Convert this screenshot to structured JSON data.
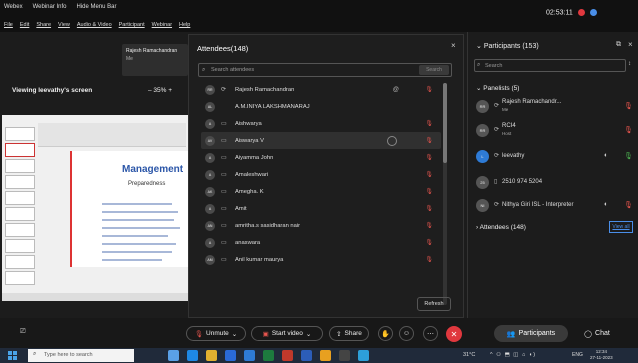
{
  "menubar": {
    "app": "Webex",
    "webinar_info": "Webinar Info",
    "hide_menu_bar": "Hide Menu Bar",
    "items": [
      "File",
      "Edit",
      "Share",
      "View",
      "Audio & Video",
      "Participant",
      "Webinar",
      "Help"
    ],
    "clock": "02:53:11"
  },
  "stage": {
    "speaker_card": {
      "name": "Rajesh Ramachandran",
      "role": "Me"
    },
    "view_label": "Viewing leevathy's screen",
    "zoom": "35%",
    "slide_title": "Management",
    "slide_subtitle": "Preparedness"
  },
  "attendees": {
    "title": "Attendees(148)",
    "search_placeholder": "Search attendees",
    "search_button": "Search",
    "refresh": "Refresh",
    "list": [
      {
        "initials": "RR",
        "name": "Rajesh Ramachandran",
        "extra": "@",
        "selected": false
      },
      {
        "initials": "AL",
        "name": "A.M.INIYA LAKSHMANARAJ",
        "extra": "",
        "selected": false
      },
      {
        "initials": "A",
        "name": "Aishwarya",
        "extra": "",
        "selected": false
      },
      {
        "initials": "AV",
        "name": "Aiswarya V",
        "extra": "",
        "selected": true
      },
      {
        "initials": "A",
        "name": "Aiyamma John",
        "extra": "",
        "selected": false
      },
      {
        "initials": "A",
        "name": "Amaleshwari",
        "extra": "",
        "selected": false
      },
      {
        "initials": "AK",
        "name": "Amegha. K",
        "extra": "",
        "selected": false
      },
      {
        "initials": "A",
        "name": "Amit",
        "extra": "",
        "selected": false
      },
      {
        "initials": "AN",
        "name": "amritha.s sasidharan nair",
        "extra": "",
        "selected": false
      },
      {
        "initials": "A",
        "name": "anaswara",
        "extra": "",
        "selected": false
      },
      {
        "initials": "AM",
        "name": "Anil kumar maurya",
        "extra": "",
        "selected": false
      }
    ]
  },
  "participants": {
    "title": "Participants (153)",
    "search_placeholder": "Search",
    "panelists_header": "Panelists (5)",
    "panelists": [
      {
        "initials": "RR",
        "name": "Rajesh Ramachandr...",
        "role": "Me"
      },
      {
        "initials": "RR",
        "name": "RCI4",
        "role": "Host"
      },
      {
        "initials": "L",
        "name": "leevathy",
        "role": ""
      },
      {
        "initials": "25",
        "name": "2510 974 5204",
        "role": ""
      },
      {
        "initials": "NI",
        "name": "Nithya Giri ISL - Interpreter",
        "role": ""
      }
    ],
    "attendees_header": "Attendees (148)",
    "view_all": "View all"
  },
  "controls": {
    "unmute": "Unmute",
    "start_video": "Start video",
    "share": "Share",
    "participants_tab": "Participants",
    "chat_tab": "Chat"
  },
  "taskbar": {
    "search_placeholder": "Type here to search",
    "temperature": "31°C",
    "language": "ENG",
    "time": "12:34",
    "date": "27-11-2023"
  },
  "colors": {
    "accent_red": "#e0383e",
    "link_blue": "#4a8ee8",
    "mic_muted": "#e8554e"
  }
}
